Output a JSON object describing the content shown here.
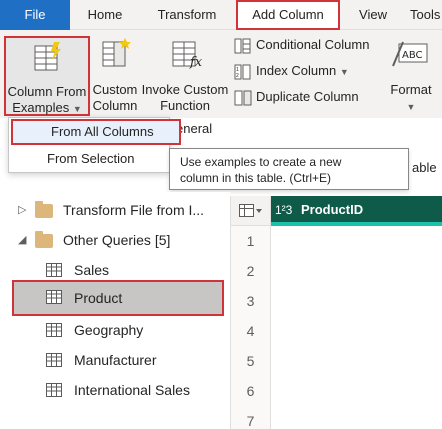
{
  "tabs": {
    "file": "File",
    "home": "Home",
    "transform": "Transform",
    "add_column": "Add Column",
    "view": "View",
    "tools": "Tools"
  },
  "ribbon": {
    "column_from_examples_line1": "Column From",
    "column_from_examples_line2": "Examples",
    "custom_column_line1": "Custom",
    "custom_column_line2": "Column",
    "invoke_custom_function_line1": "Invoke Custom",
    "invoke_custom_function_line2": "Function",
    "conditional_column": "Conditional Column",
    "index_column": "Index Column",
    "duplicate_column": "Duplicate Column",
    "format": "Format",
    "general_fragment": "eneral"
  },
  "menu": {
    "from_all_columns": "From All Columns",
    "from_selection": "From Selection"
  },
  "tooltip": {
    "line1": "Use examples to create a new",
    "line2": "column in this table. (Ctrl+E)"
  },
  "queries": {
    "transform_file": "Transform File from I...",
    "other_queries": "Other Queries [5]",
    "items": [
      "Sales",
      "Product",
      "Geography",
      "Manufacturer",
      "International Sales"
    ]
  },
  "formula_bar": {
    "fragment": "able"
  },
  "grid": {
    "type_label": "1²3",
    "column_header": "ProductID",
    "row_numbers": [
      "1",
      "2",
      "3",
      "4",
      "5",
      "6",
      "7"
    ]
  }
}
